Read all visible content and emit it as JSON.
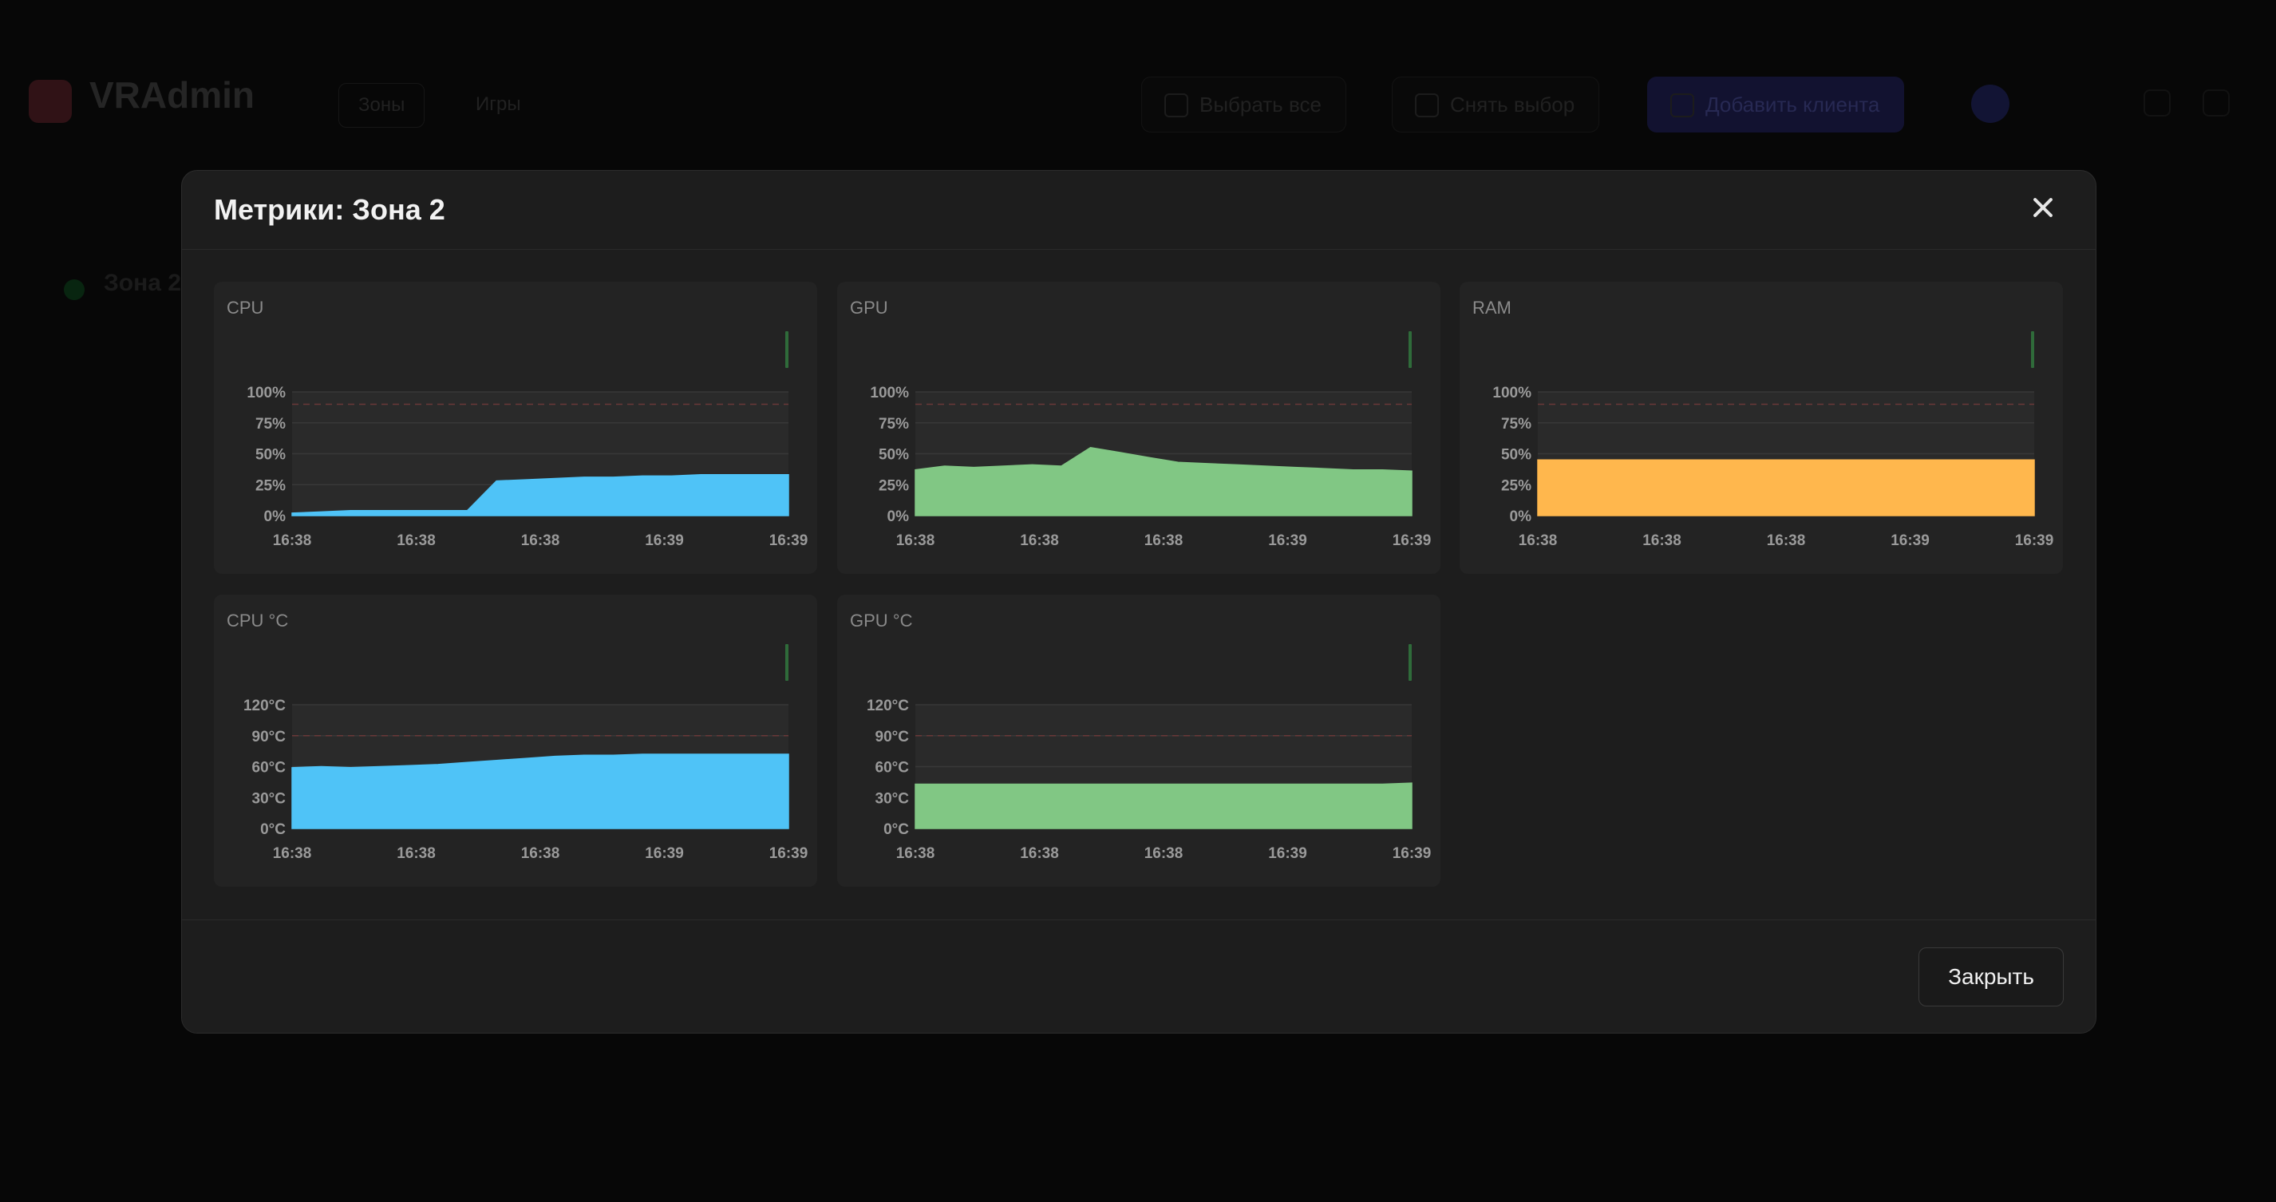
{
  "background": {
    "app_title": "VRAdmin",
    "app_subtitle": "",
    "tabs": [
      "Зоны",
      "Игры"
    ],
    "buttons": [
      "Выбрать все",
      "Снять выбор",
      "Добавить клиента"
    ],
    "user": "",
    "zone": "Зона 2"
  },
  "modal": {
    "title": "Метрики: Зона 2",
    "close_button": "Закрыть",
    "close_icon": "close-icon"
  },
  "x_ticks": [
    "16:38",
    "16:38",
    "16:38",
    "16:39",
    "16:39"
  ],
  "chart_data": [
    {
      "type": "area",
      "title": "CPU",
      "color": "#4fc3f7",
      "unit": "%",
      "ylim": [
        0,
        100
      ],
      "y_ticks": [
        "0%",
        "25%",
        "50%",
        "75%",
        "100%"
      ],
      "threshold": 90,
      "values": [
        2,
        3,
        4,
        4,
        4,
        4,
        4,
        28,
        29,
        30,
        31,
        31,
        32,
        32,
        33,
        33,
        33,
        33
      ]
    },
    {
      "type": "area",
      "title": "GPU",
      "color": "#81c784",
      "unit": "%",
      "ylim": [
        0,
        100
      ],
      "y_ticks": [
        "0%",
        "25%",
        "50%",
        "75%",
        "100%"
      ],
      "threshold": 90,
      "values": [
        37,
        40,
        39,
        40,
        41,
        40,
        55,
        51,
        47,
        43,
        42,
        41,
        40,
        39,
        38,
        37,
        37,
        36
      ]
    },
    {
      "type": "area",
      "title": "RAM",
      "color": "#ffb74d",
      "unit": "%",
      "ylim": [
        0,
        100
      ],
      "y_ticks": [
        "0%",
        "25%",
        "50%",
        "75%",
        "100%"
      ],
      "threshold": 90,
      "values": [
        45,
        45,
        45,
        45,
        45,
        45,
        45,
        45,
        45,
        45,
        45,
        45,
        45,
        45,
        45,
        45,
        45,
        45
      ]
    },
    {
      "type": "area",
      "title": "CPU °C",
      "color": "#4fc3f7",
      "unit": "°C",
      "ylim": [
        0,
        120
      ],
      "y_ticks": [
        "0°C",
        "30°C",
        "60°C",
        "90°C",
        "120°C"
      ],
      "threshold": 90,
      "values": [
        59,
        60,
        59,
        60,
        61,
        62,
        64,
        66,
        68,
        70,
        71,
        71,
        72,
        72,
        72,
        72,
        72,
        72
      ]
    },
    {
      "type": "area",
      "title": "GPU °C",
      "color": "#81c784",
      "unit": "°C",
      "ylim": [
        0,
        120
      ],
      "y_ticks": [
        "0°C",
        "30°C",
        "60°C",
        "90°C",
        "120°C"
      ],
      "threshold": 90,
      "values": [
        43,
        43,
        43,
        43,
        43,
        43,
        43,
        43,
        43,
        43,
        43,
        43,
        43,
        43,
        43,
        43,
        43,
        44
      ]
    }
  ]
}
